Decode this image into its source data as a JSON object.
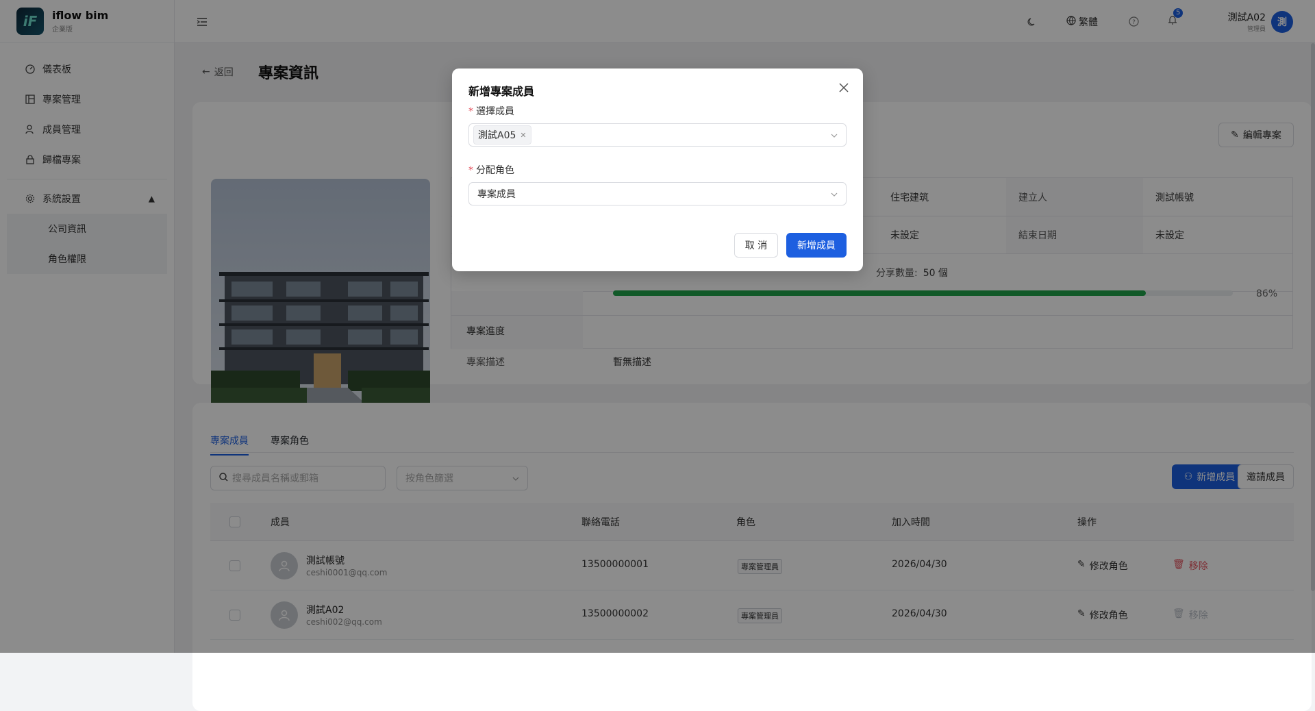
{
  "brand": {
    "name": "iflow bim",
    "edition": "企業版",
    "logo_text": "iF"
  },
  "sidebar": {
    "items": [
      {
        "label": "儀表板",
        "icon": "dashboard-icon"
      },
      {
        "label": "專案管理",
        "icon": "project-icon"
      },
      {
        "label": "成員管理",
        "icon": "users-icon"
      },
      {
        "label": "歸檔專案",
        "icon": "archive-icon"
      }
    ],
    "group": {
      "label": "系統設置",
      "icon": "gear-icon",
      "expanded": true,
      "children": [
        {
          "label": "公司資訊"
        },
        {
          "label": "角色權限"
        }
      ]
    }
  },
  "topbar": {
    "language": "繁體",
    "notifications": "5",
    "user_name": "測試A02",
    "user_role": "管理員",
    "avatar_text": "測"
  },
  "page": {
    "back_label": "返回",
    "title": "專案資訊",
    "project_name_initial": "",
    "edit_label": "編輯專案"
  },
  "info": {
    "building_type": "住宅建筑",
    "creator_label": "建立人",
    "creator_value": "測試帳號",
    "start_value": "未設定",
    "end_label": "結束日期",
    "end_value": "未設定",
    "share_label": "分享數量:",
    "share_value": "50 個",
    "progress_label": "專案進度",
    "progress_pct": 86,
    "progress_text": "86%",
    "desc_label": "專案描述",
    "desc_value": "暫無描述"
  },
  "members": {
    "tabs": [
      "專案成員",
      "專案角色"
    ],
    "search_placeholder": "搜尋成員名稱或郵箱",
    "filter_placeholder": "按角色篩選",
    "add_label": "新增成員",
    "invite_label": "邀請成員",
    "columns": [
      "成員",
      "聯絡電話",
      "角色",
      "加入時間",
      "操作"
    ],
    "rows": [
      {
        "name": "測試帳號",
        "email": "ceshi0001@qq.com",
        "phone": "13500000001",
        "role": "專案管理員",
        "joined": "2026/04/30",
        "edit": "修改角色",
        "remove": "移除"
      },
      {
        "name": "測試A02",
        "email": "ceshi002@qq.com",
        "phone": "13500000002",
        "role": "專案管理員",
        "joined": "2026/04/30",
        "edit": "修改角色",
        "remove": "移除"
      }
    ]
  },
  "modal": {
    "title": "新增專案成員",
    "member_label": "選擇成員",
    "selected_member": "測試A05",
    "role_label": "分配角色",
    "selected_role": "專案成員",
    "cancel_label": "取 消",
    "confirm_label": "新增成員"
  },
  "colors": {
    "primary": "#1d5fe0",
    "progress": "#1fa34a",
    "danger": "#e34d59"
  }
}
